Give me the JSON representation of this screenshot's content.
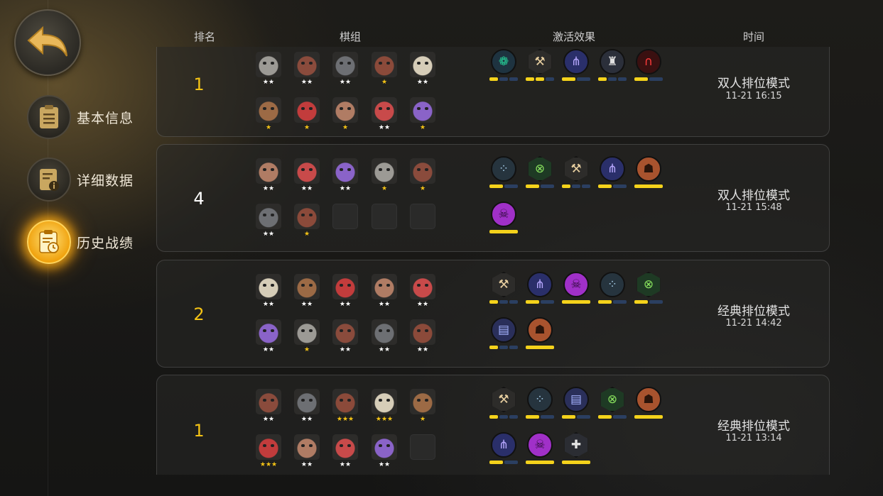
{
  "sidebar": {
    "items": [
      {
        "label": "基本信息",
        "icon": "clipboard-icon",
        "active": false
      },
      {
        "label": "详细数据",
        "icon": "data-sheet-icon",
        "active": false
      },
      {
        "label": "历史战绩",
        "icon": "history-clock-icon",
        "active": true
      }
    ]
  },
  "headers": {
    "rank": "排名",
    "pieces": "棋组",
    "traits": "激活效果",
    "time": "时间"
  },
  "colors": {
    "gold": "#f4c315",
    "bar_on": "#f4d21b",
    "bar_off": "#2b3f61",
    "star_white": "#ffffff",
    "star_gold": "#f4c315"
  },
  "records": [
    {
      "rank": "1",
      "mode": "双人排位模式",
      "time": "11-21 16:15",
      "pieces": [
        {
          "star_count": 2,
          "star_color": "white"
        },
        {
          "star_count": 2,
          "star_color": "white"
        },
        {
          "star_count": 2,
          "star_color": "white"
        },
        {
          "star_count": 1,
          "star_color": "gold"
        },
        {
          "star_count": 2,
          "star_color": "white"
        },
        {
          "star_count": 1,
          "star_color": "gold"
        },
        {
          "star_count": 1,
          "star_color": "gold"
        },
        {
          "star_count": 1,
          "star_color": "gold"
        },
        {
          "star_count": 2,
          "star_color": "white"
        },
        {
          "star_count": 1,
          "star_color": "gold"
        }
      ],
      "traits": [
        {
          "icon": "paw-icon",
          "level": 1,
          "max": 3
        },
        {
          "icon": "axe-icon",
          "level": 2,
          "max": 3
        },
        {
          "icon": "fish-bone-icon",
          "level": 1,
          "max": 2
        },
        {
          "icon": "knight-icon",
          "level": 1,
          "max": 3
        },
        {
          "icon": "arch-icon",
          "level": 1,
          "max": 2
        }
      ]
    },
    {
      "rank": "4",
      "mode": "双人排位模式",
      "time": "11-21 15:48",
      "pieces": [
        {
          "star_count": 2,
          "star_color": "white"
        },
        {
          "star_count": 2,
          "star_color": "white"
        },
        {
          "star_count": 2,
          "star_color": "white"
        },
        {
          "star_count": 1,
          "star_color": "gold"
        },
        {
          "star_count": 1,
          "star_color": "gold"
        },
        {
          "star_count": 2,
          "star_color": "white"
        },
        {
          "star_count": 1,
          "star_color": "gold"
        },
        {
          "star_count": 0
        },
        {
          "star_count": 0
        },
        {
          "star_count": 0
        }
      ],
      "traits": [
        {
          "icon": "footprints-icon",
          "level": 1,
          "max": 2
        },
        {
          "icon": "crossbow-icon",
          "level": 1,
          "max": 2
        },
        {
          "icon": "axe-icon",
          "level": 1,
          "max": 3
        },
        {
          "icon": "fish-bone-icon",
          "level": 1,
          "max": 2
        },
        {
          "icon": "demon-icon",
          "level": 1,
          "max": 1
        },
        {
          "icon": "ghost-skull-icon",
          "level": 1,
          "max": 1
        }
      ]
    },
    {
      "rank": "2",
      "mode": "经典排位模式",
      "time": "11-21 14:42",
      "pieces": [
        {
          "star_count": 2,
          "star_color": "white"
        },
        {
          "star_count": 2,
          "star_color": "white"
        },
        {
          "star_count": 2,
          "star_color": "white"
        },
        {
          "star_count": 2,
          "star_color": "white"
        },
        {
          "star_count": 2,
          "star_color": "white"
        },
        {
          "star_count": 2,
          "star_color": "white"
        },
        {
          "star_count": 1,
          "star_color": "gold"
        },
        {
          "star_count": 2,
          "star_color": "white"
        },
        {
          "star_count": 2,
          "star_color": "white"
        },
        {
          "star_count": 2,
          "star_color": "white"
        }
      ],
      "traits": [
        {
          "icon": "axe-icon",
          "level": 1,
          "max": 3
        },
        {
          "icon": "fish-bone-icon",
          "level": 1,
          "max": 2
        },
        {
          "icon": "ghost-skull-icon",
          "level": 1,
          "max": 1
        },
        {
          "icon": "footprints-icon",
          "level": 1,
          "max": 2
        },
        {
          "icon": "crossbow-icon",
          "level": 1,
          "max": 2
        },
        {
          "icon": "spellbook-icon",
          "level": 1,
          "max": 3
        },
        {
          "icon": "demon-icon",
          "level": 1,
          "max": 1
        }
      ]
    },
    {
      "rank": "1",
      "mode": "经典排位模式",
      "time": "11-21 13:14",
      "pieces": [
        {
          "star_count": 2,
          "star_color": "white"
        },
        {
          "star_count": 2,
          "star_color": "white"
        },
        {
          "star_count": 3,
          "star_color": "gold"
        },
        {
          "star_count": 3,
          "star_color": "gold"
        },
        {
          "star_count": 1,
          "star_color": "gold"
        },
        {
          "star_count": 3,
          "star_color": "gold"
        },
        {
          "star_count": 2,
          "star_color": "white"
        },
        {
          "star_count": 2,
          "star_color": "white"
        },
        {
          "star_count": 2,
          "star_color": "white"
        },
        {
          "star_count": 0
        }
      ],
      "traits": [
        {
          "icon": "axe-icon",
          "level": 1,
          "max": 3
        },
        {
          "icon": "footprints-icon",
          "level": 1,
          "max": 2
        },
        {
          "icon": "spellbook-icon",
          "level": 1,
          "max": 2
        },
        {
          "icon": "crossbow-icon",
          "level": 1,
          "max": 2
        },
        {
          "icon": "demon-icon",
          "level": 1,
          "max": 1
        },
        {
          "icon": "fish-bone-icon",
          "level": 1,
          "max": 2
        },
        {
          "icon": "ghost-skull-icon",
          "level": 1,
          "max": 1
        },
        {
          "icon": "cross-icon",
          "level": 1,
          "max": 1
        }
      ]
    }
  ]
}
